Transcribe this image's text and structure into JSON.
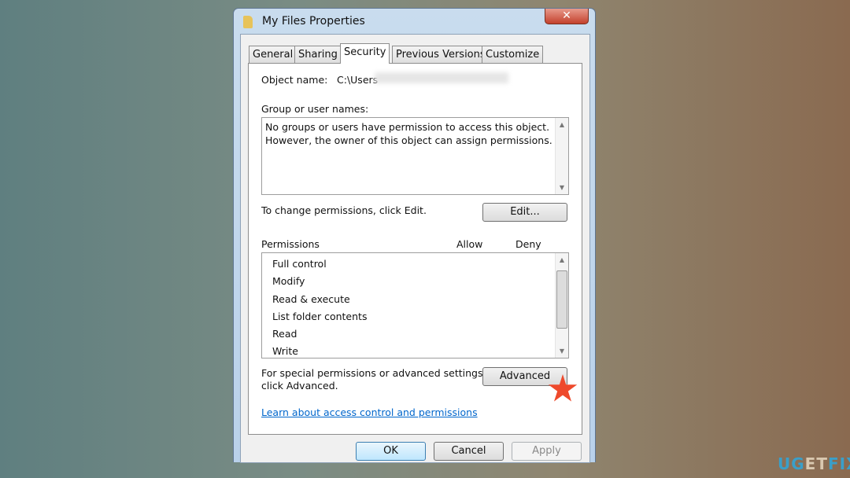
{
  "window": {
    "title": "My Files Properties",
    "close_label": "✕"
  },
  "tabs": [
    {
      "label": "General"
    },
    {
      "label": "Sharing"
    },
    {
      "label": "Security",
      "active": true
    },
    {
      "label": "Previous Versions"
    },
    {
      "label": "Customize"
    }
  ],
  "security": {
    "object_name_label": "Object name:",
    "object_name_value": "C:\\Users",
    "group_label": "Group or user names:",
    "group_message": [
      "No groups or users have permission to access this object.",
      "However, the owner of this object can assign permissions."
    ],
    "change_hint": "To change permissions, click Edit.",
    "edit_label": "Edit...",
    "permissions_label": "Permissions",
    "allow_label": "Allow",
    "deny_label": "Deny",
    "permissions": [
      "Full control",
      "Modify",
      "Read & execute",
      "List folder contents",
      "Read",
      "Write"
    ],
    "special_hint": [
      "For special permissions or advanced settings,",
      "click Advanced."
    ],
    "advanced_label": "Advanced",
    "learn_link": "Learn about access control and permissions"
  },
  "buttons": {
    "ok": "OK",
    "cancel": "Cancel",
    "apply": "Apply"
  },
  "watermark": {
    "a": "UG",
    "b": "ET",
    "c": "FIX"
  },
  "colors": {
    "link": "#0066cc",
    "highlight_star": "#ee4a2c"
  }
}
